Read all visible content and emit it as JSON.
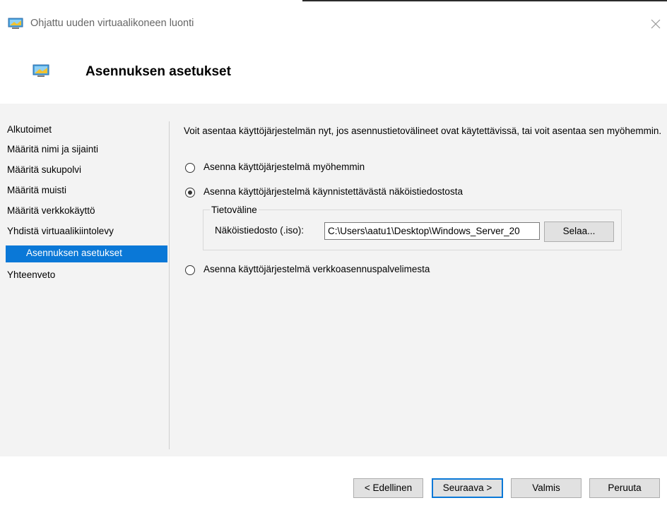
{
  "window": {
    "title": "Ohjattu uuden virtuaalikoneen luonti",
    "close_glyph": "×",
    "icon": "hyper-v-vm-icon"
  },
  "header": {
    "title": "Asennuksen asetukset",
    "icon": "hyper-v-vm-icon"
  },
  "nav": {
    "items": [
      {
        "label": "Alkutoimet"
      },
      {
        "label": "Määritä nimi ja sijainti"
      },
      {
        "label": "Määritä sukupolvi"
      },
      {
        "label": "Määritä muisti"
      },
      {
        "label": "Määritä verkkokäyttö"
      },
      {
        "label": "Yhdistä virtuaalikiintolevy"
      },
      {
        "label": "Asennuksen asetukset",
        "selected": true
      },
      {
        "label": "Yhteenveto"
      }
    ]
  },
  "content": {
    "intro": "Voit asentaa käyttöjärjestelmän nyt, jos asennustietovälineet ovat käytettävissä, tai voit asentaa sen myöhemmin.",
    "options": [
      {
        "label": "Asenna käyttöjärjestelmä myöhemmin",
        "checked": false
      },
      {
        "label": "Asenna käyttöjärjestelmä käynnistettävästä näköistiedostosta",
        "checked": true
      },
      {
        "label": "Asenna käyttöjärjestelmä verkkoasennuspalvelimesta",
        "checked": false
      }
    ],
    "media_group": {
      "legend": "Tietoväline",
      "file_label": "Näköistiedosto (.iso):",
      "file_value": "C:\\Users\\aatu1\\Desktop\\Windows_Server_20",
      "browse_label": "Selaa..."
    }
  },
  "footer": {
    "back_label": "< Edellinen",
    "next_label": "Seuraava >",
    "finish_label": "Valmis",
    "cancel_label": "Peruuta"
  },
  "colors": {
    "accent": "#0a78d7",
    "panel": "#f3f3f3",
    "button": "#e1e1e1"
  }
}
